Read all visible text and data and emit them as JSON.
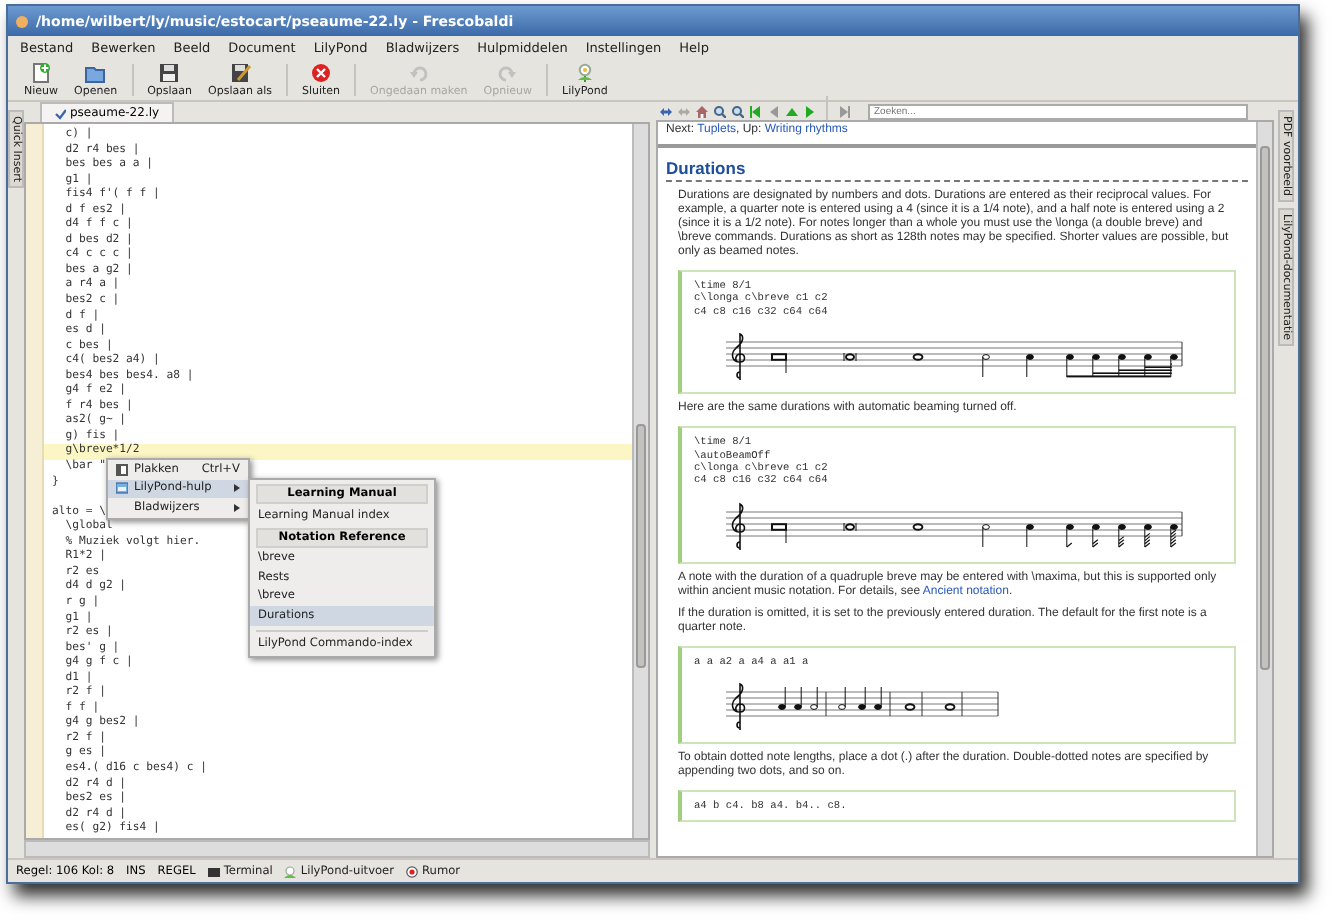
{
  "window": {
    "title": "/home/wilbert/ly/music/estocart/pseaume-22.ly - Frescobaldi"
  },
  "menu_bar": [
    "Bestand",
    "Bewerken",
    "Beeld",
    "Document",
    "LilyPond",
    "Bladwijzers",
    "Hulpmiddelen",
    "Instellingen",
    "Help"
  ],
  "toolbar": [
    {
      "label": "Nieuw",
      "disabled": false
    },
    {
      "label": "Openen",
      "disabled": false
    },
    {
      "label": "Opslaan",
      "disabled": false
    },
    {
      "label": "Opslaan als",
      "disabled": false
    },
    {
      "label": "Sluiten",
      "disabled": false
    },
    {
      "label": "Ongedaan maken",
      "disabled": true
    },
    {
      "label": "Opnieuw",
      "disabled": true
    },
    {
      "label": "LilyPond",
      "disabled": false
    }
  ],
  "left_dock_tabs": [
    {
      "label": "Quick Insert"
    }
  ],
  "editor": {
    "tab": {
      "label": "pseaume-22.ly",
      "selected": true
    },
    "lines": [
      {
        "text": "  c) |",
        "current": false
      },
      {
        "text": "  d2 r4 bes |",
        "current": false
      },
      {
        "text": "  bes bes a a |",
        "current": false
      },
      {
        "text": "  g1 |",
        "current": false
      },
      {
        "text": "  fis4 f'( f f |",
        "current": false
      },
      {
        "text": "  d f es2 |",
        "current": false
      },
      {
        "text": "  d4 f f c |",
        "current": false
      },
      {
        "text": "  d bes d2 |",
        "current": false
      },
      {
        "text": "  c4 c c c |",
        "current": false
      },
      {
        "text": "  bes a g2 |",
        "current": false
      },
      {
        "text": "  a r4 a |",
        "current": false
      },
      {
        "text": "  bes2 c |",
        "current": false
      },
      {
        "text": "  d f |",
        "current": false
      },
      {
        "text": "  es d |",
        "current": false
      },
      {
        "text": "  c bes |",
        "current": false
      },
      {
        "text": "  c4( bes2 a4) |",
        "current": false
      },
      {
        "text": "  bes4 bes bes4. a8 |",
        "current": false
      },
      {
        "text": "  g4 f e2 |",
        "current": false
      },
      {
        "text": "  f r4 bes |",
        "current": false
      },
      {
        "text": "  as2( g~ |",
        "current": false
      },
      {
        "text": "  g) fis |",
        "current": false
      },
      {
        "text": "  g\\breve*1/2",
        "current": true
      },
      {
        "text": "  \\bar \"",
        "current": false
      },
      {
        "text": "}",
        "current": false
      },
      {
        "current": false
      },
      {
        "text": "alto = \\",
        "current": false
      },
      {
        "text": "  \\global",
        "current": false
      },
      {
        "text": "  % Muziek volgt hier.",
        "current": false
      },
      {
        "text": "  R1*2 |",
        "current": false
      },
      {
        "text": "  r2 es",
        "current": false
      },
      {
        "text": "  d4 d g2 |",
        "current": false
      },
      {
        "text": "  r g |",
        "current": false
      },
      {
        "text": "  g1 |",
        "current": false
      },
      {
        "text": "  r2 es |",
        "current": false
      },
      {
        "text": "  bes' g |",
        "current": false
      },
      {
        "text": "  g4 g f c |",
        "current": false
      },
      {
        "text": "  d1 |",
        "current": false
      },
      {
        "text": "  r2 f |",
        "current": false
      },
      {
        "text": "  f f |",
        "current": false
      },
      {
        "text": "  g4 g bes2 |",
        "current": false
      },
      {
        "text": "  r2 f |",
        "current": false
      },
      {
        "text": "  g es |",
        "current": false
      },
      {
        "text": "  es4.( d16 c bes4) c |",
        "current": false
      },
      {
        "text": "  d2 r4 d |",
        "current": false
      },
      {
        "text": "  bes2 es |",
        "current": false
      },
      {
        "text": "  d2 r4 d |",
        "current": false
      },
      {
        "text": "  es( g2) fis4 |",
        "current": false
      }
    ],
    "context_menu": [
      {
        "label": "Plakken",
        "shortcut": "Ctrl+V",
        "submenu": false,
        "selected": false
      },
      {
        "label": "LilyPond-hulp",
        "submenu": true,
        "selected": true
      },
      {
        "label": "Bladwijzers",
        "submenu": true,
        "selected": false
      }
    ],
    "submenu": [
      {
        "kind": "header",
        "label": "Learning Manual"
      },
      {
        "kind": "item",
        "label": "Learning Manual index",
        "selected": false
      },
      {
        "kind": "header",
        "label": "Notation Reference"
      },
      {
        "kind": "item",
        "label": "\\breve",
        "selected": false
      },
      {
        "kind": "item",
        "label": "Rests",
        "selected": false
      },
      {
        "kind": "item",
        "label": "\\breve",
        "selected": false
      },
      {
        "kind": "item",
        "label": "Durations",
        "selected": true
      },
      {
        "kind": "separator"
      },
      {
        "kind": "item",
        "label": "LilyPond Commando-index",
        "selected": false
      }
    ]
  },
  "doc_viewer": {
    "search": {
      "placeholder": "Zoeken..."
    },
    "nav": {
      "next_label": "Next: ",
      "next": "Tuplets",
      "up_label": ", Up: ",
      "up": "Writing rhythms"
    },
    "title": "Durations",
    "blocks": [
      {
        "kind": "paragraph",
        "text": "Durations are designated by numbers and dots. Durations are entered as their reciprocal values. For example, a quarter note is entered using a 4 (since it is a 1/4 note), and a half note is entered using a 2 (since it is a 1/2 note). For notes longer than a whole you must use the \\longa (a double breve) and \\breve commands. Durations as short as 128th notes may be specified. Shorter values are possible, but only as beamed notes."
      },
      {
        "kind": "example",
        "code": [
          "\\time 8/1",
          "c\\longa c\\breve c1 c2",
          "c4 c8 c16 c32 c64 c64"
        ],
        "staff": {
          "kind": "beamed"
        }
      },
      {
        "kind": "paragraph",
        "text": "Here are the same durations with automatic beaming turned off."
      },
      {
        "kind": "example",
        "code": [
          "\\time 8/1",
          "\\autoBeamOff",
          "c\\longa c\\breve c1 c2",
          "c4 c8 c16 c32 c64 c64"
        ],
        "staff": {
          "kind": "flagged"
        }
      },
      {
        "kind": "paragraph",
        "text": "A note with the duration of a quadruple breve may be entered with \\maxima, but this is supported only within ancient music notation. For details, see ",
        "link": "Ancient notation",
        "after": "."
      },
      {
        "kind": "paragraph",
        "text": "If the duration is omitted, it is set to the previously entered duration. The default for the first note is a quarter note."
      },
      {
        "kind": "example",
        "code": [
          "a a a2 a a4 a a1 a"
        ],
        "staff": {
          "kind": "quarters"
        }
      },
      {
        "kind": "paragraph",
        "text": "To obtain dotted note lengths, place a dot (.) after the duration. Double-dotted notes are specified by appending two dots, and so on."
      },
      {
        "kind": "example",
        "code": [
          "a4 b c4. b8 a4. b4.. c8."
        ]
      }
    ]
  },
  "right_dock_tabs": [
    {
      "label": "PDF voorbeeld"
    },
    {
      "label": "LilyPond-documentatie"
    }
  ],
  "status_bar": {
    "position": "Regel: 106 Kol: 8",
    "mode": "INS",
    "selection_mode": "REGEL",
    "panels": [
      "Terminal",
      "LilyPond-uitvoer",
      "Rumor"
    ]
  }
}
